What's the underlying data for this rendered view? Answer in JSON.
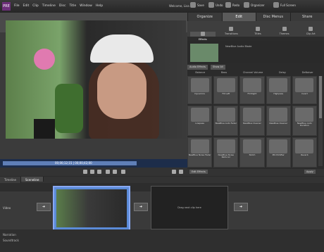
{
  "app": {
    "logo": "PRE"
  },
  "menu": [
    "File",
    "Edit",
    "Clip",
    "Timeline",
    "Disc",
    "Title",
    "Window",
    "Help"
  ],
  "welcome": "Welcome, Lisa",
  "toolbar": {
    "save": "Save",
    "undo": "Undo",
    "redo": "Redo",
    "organizer": "Organizer",
    "fullscreen": "Full Screen"
  },
  "preview": {
    "timecode": "00;00;12;15 | 00;00;42;00"
  },
  "tabs": [
    "Organize",
    "Edit",
    "Disc Menus",
    "Share"
  ],
  "subtabs": [
    "Effects",
    "Transitions",
    "Titles",
    "Themes",
    "Clip Art"
  ],
  "thumb": {
    "label": "NewBlue Audio Blade"
  },
  "filter": {
    "type": "Audio Effects",
    "show": "Show All"
  },
  "categories": [
    "Balance",
    "Bass",
    "Channel Volume",
    "Delay",
    "DeNoiser"
  ],
  "effects": [
    "Dynamics",
    "Fill Left",
    "Fill Right",
    "Highpass",
    "Invert",
    "Lowpass",
    "NewBlue Auto Fader",
    "NewBlue Cleaner",
    "NewBlue Cleaner",
    "NewBlue Auto Duration",
    "NewBlue Noise Fader",
    "NewBlue Noise Reducer",
    "Notch",
    "PitchShifter",
    "Reverb"
  ],
  "editfx": {
    "label": "Edit Effects",
    "apply": "Apply"
  },
  "timeline": {
    "tabs": [
      "Timeline",
      "Sceneline"
    ],
    "video": "Video",
    "drop": "Drag next clip here",
    "narration": "Narration",
    "soundtrack": "Soundtrack"
  }
}
